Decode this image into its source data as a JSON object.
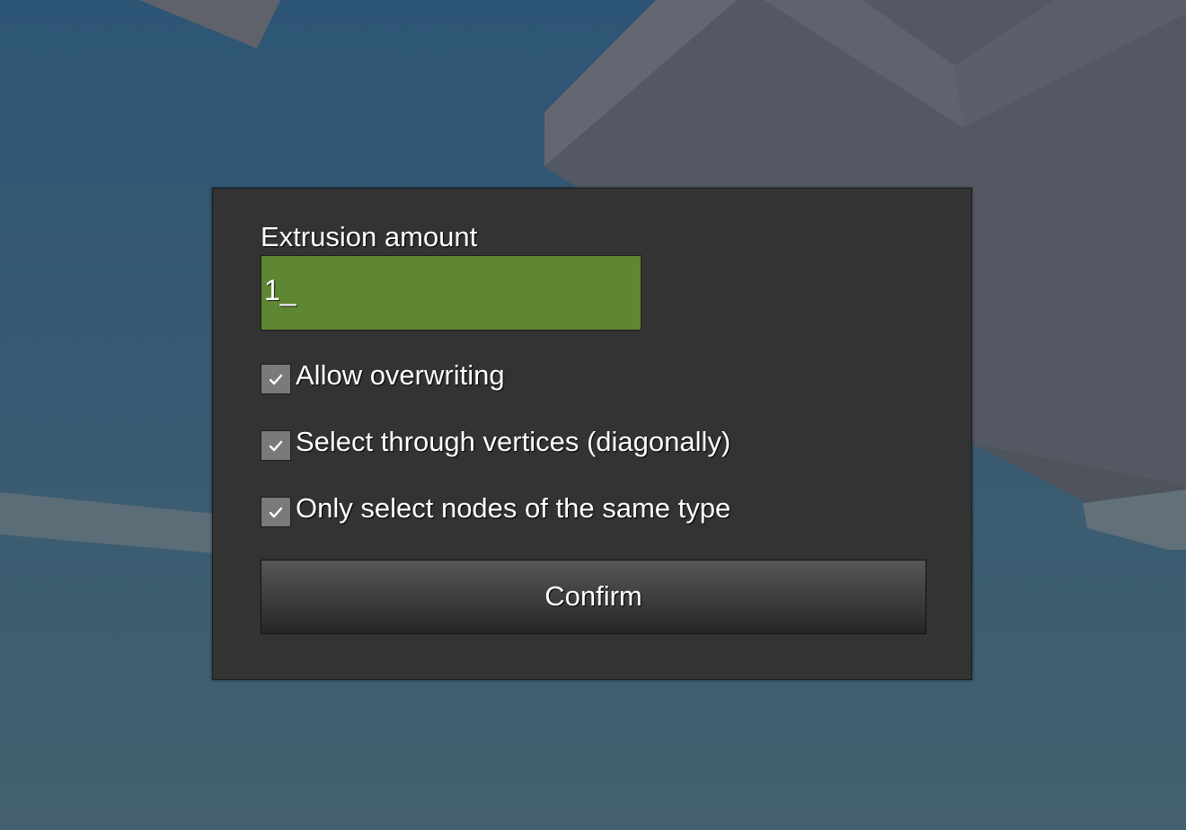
{
  "background": {
    "sky_top": "#2d5575",
    "sky_bottom": "#44606f",
    "block_color": "#545863"
  },
  "dialog": {
    "extrusion": {
      "label": "Extrusion amount",
      "value": "1_",
      "field_color": "#5f8733"
    },
    "options": [
      {
        "label": "Allow overwriting",
        "checked": true,
        "icon": "checkmark-icon"
      },
      {
        "label": "Select through vertices (diagonally)",
        "checked": true,
        "icon": "checkmark-icon"
      },
      {
        "label": "Only select nodes of the same type",
        "checked": true,
        "icon": "checkmark-icon"
      }
    ],
    "confirm_label": "Confirm"
  }
}
